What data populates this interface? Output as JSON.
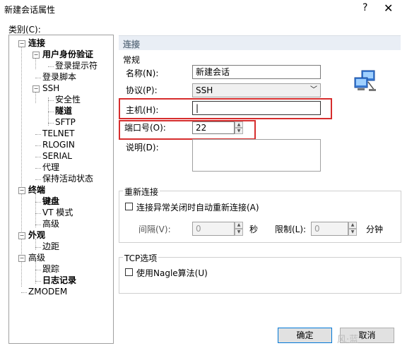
{
  "window": {
    "title": "新建会话属性",
    "help": "?",
    "close": "✕"
  },
  "category_label": "类别(C):",
  "tree": [
    {
      "label": "连接",
      "toggle": "−",
      "bold": true
    },
    {
      "label": "用户身份验证",
      "toggle": "−",
      "bold": true
    },
    {
      "label": "登录提示符",
      "toggle": "",
      "bold": false
    },
    {
      "label": "登录脚本",
      "toggle": "",
      "bold": false
    },
    {
      "label": "SSH",
      "toggle": "−",
      "bold": false
    },
    {
      "label": "安全性",
      "toggle": "",
      "bold": false
    },
    {
      "label": "隧道",
      "toggle": "",
      "bold": true
    },
    {
      "label": "SFTP",
      "toggle": "",
      "bold": false
    },
    {
      "label": "TELNET",
      "toggle": "",
      "bold": false
    },
    {
      "label": "RLOGIN",
      "toggle": "",
      "bold": false
    },
    {
      "label": "SERIAL",
      "toggle": "",
      "bold": false
    },
    {
      "label": "代理",
      "toggle": "",
      "bold": false
    },
    {
      "label": "保持活动状态",
      "toggle": "",
      "bold": false
    },
    {
      "label": "终端",
      "toggle": "−",
      "bold": true
    },
    {
      "label": "键盘",
      "toggle": "",
      "bold": true
    },
    {
      "label": "VT 模式",
      "toggle": "",
      "bold": false
    },
    {
      "label": "高级",
      "toggle": "",
      "bold": false
    },
    {
      "label": "外观",
      "toggle": "−",
      "bold": true
    },
    {
      "label": "边距",
      "toggle": "",
      "bold": false
    },
    {
      "label": "高级",
      "toggle": "−",
      "bold": false
    },
    {
      "label": "跟踪",
      "toggle": "",
      "bold": false
    },
    {
      "label": "日志记录",
      "toggle": "",
      "bold": true
    },
    {
      "label": "ZMODEM",
      "toggle": "",
      "bold": false
    }
  ],
  "panel": {
    "header": "连接",
    "general": {
      "title": "常规",
      "name_label": "名称(N):",
      "name_value": "新建会话",
      "protocol_label": "协议(P):",
      "protocol_value": "SSH",
      "host_label": "主机(H):",
      "host_value": "|",
      "port_label": "端口号(O):",
      "port_value": "22",
      "desc_label": "说明(D):",
      "desc_value": ""
    },
    "reconnect": {
      "title": "重新连接",
      "auto_label": "连接异常关闭时自动重新连接(A)",
      "interval_label": "间隔(V):",
      "interval_value": "0",
      "interval_unit": "秒",
      "limit_label": "限制(L):",
      "limit_value": "0",
      "limit_unit": "分钟"
    },
    "tcp": {
      "title": "TCP选项",
      "nagle_label": "使用Nagle算法(U)"
    }
  },
  "buttons": {
    "ok": "确定",
    "cancel": "取消"
  },
  "watermark": "风·蓝",
  "colors": {
    "highlight": "#d62d2d",
    "header_bg": "#e9eef5"
  }
}
